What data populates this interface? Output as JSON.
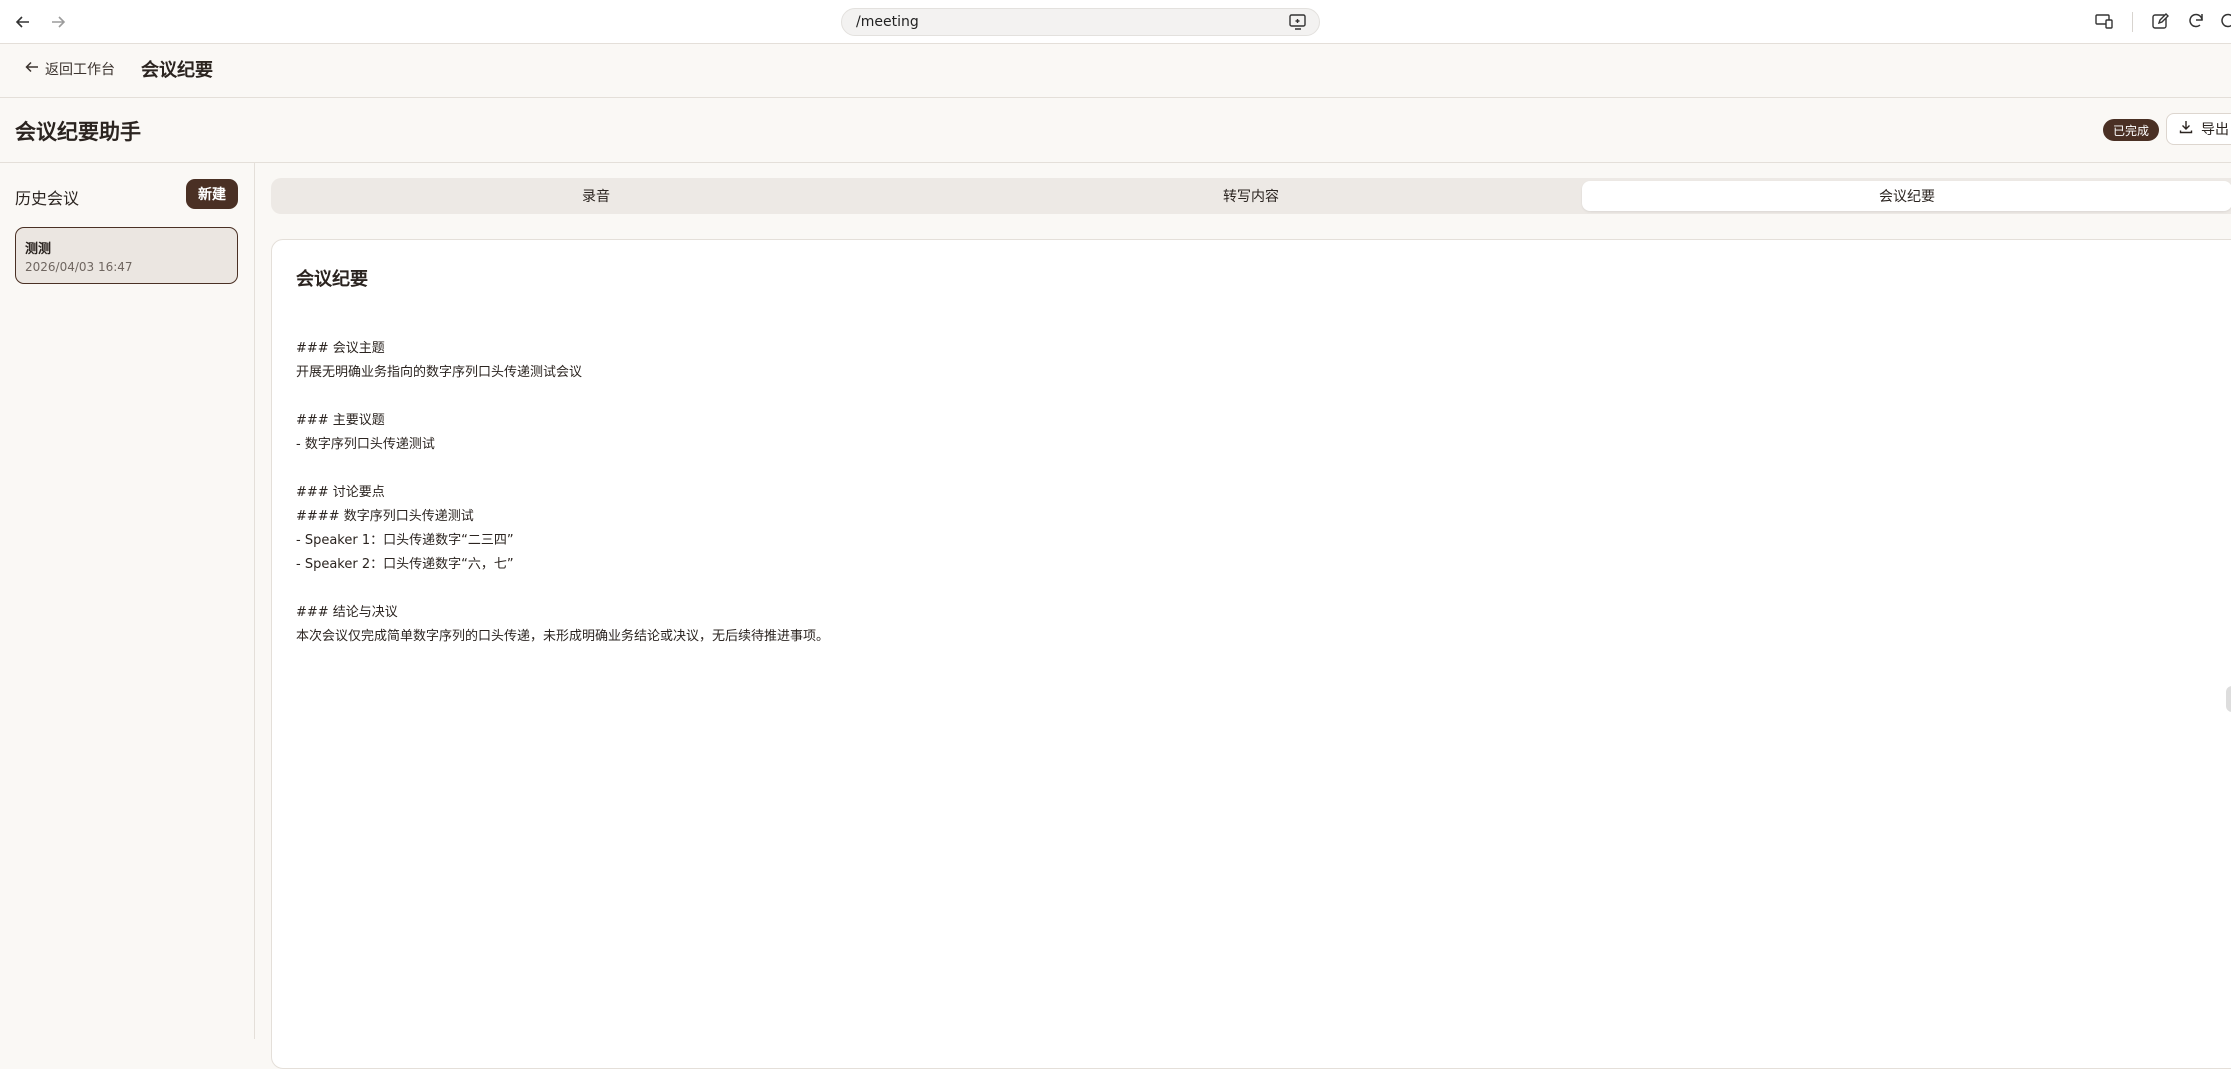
{
  "browser": {
    "url": "/meeting"
  },
  "header": {
    "back_label": "返回工作台",
    "title": "会议纪要"
  },
  "page": {
    "title": "会议纪要助手",
    "status": "已完成",
    "export_label": "导出"
  },
  "sidebar": {
    "heading": "历史会议",
    "new_button": "新建",
    "meetings": [
      {
        "name": "测测",
        "time": "2026/04/03 16:47"
      }
    ]
  },
  "tabs": [
    {
      "label": "录音"
    },
    {
      "label": "转写内容"
    },
    {
      "label": "会议纪要",
      "active": true
    }
  ],
  "minutes": {
    "title": "会议纪要",
    "lines": [
      "### 会议主题",
      "开展无明确业务指向的数字序列口头传递测试会议",
      "",
      "### 主要议题",
      "- 数字序列口头传递测试",
      "",
      "### 讨论要点",
      "#### 数字序列口头传递测试",
      "- Speaker 1：口头传递数字“二三四”",
      "- Speaker 2：口头传递数字“六，七”",
      "",
      "### 结论与决议",
      "本次会议仅完成简单数字序列的口头传递，未形成明确业务结论或决议，无后续待推进事项。"
    ]
  }
}
